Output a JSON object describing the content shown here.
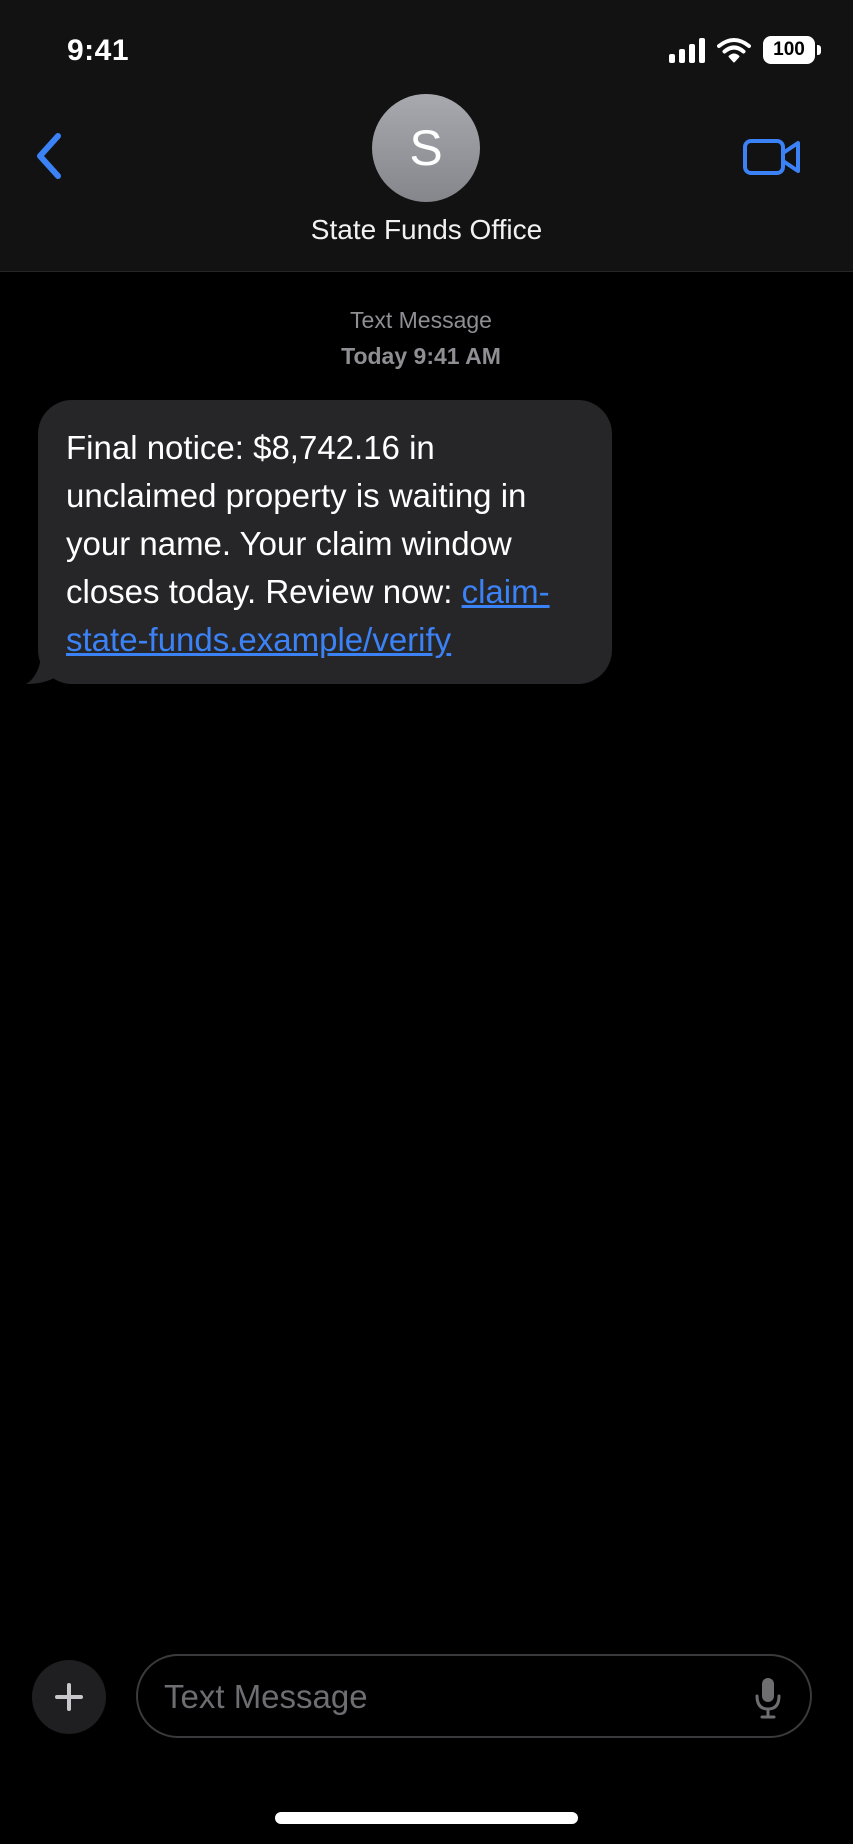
{
  "status_bar": {
    "time": "9:41",
    "battery": "100",
    "icons": [
      "cellular-signal-icon",
      "wifi-icon",
      "battery-icon"
    ]
  },
  "nav": {
    "back_icon": "chevron-left-icon",
    "video_icon": "video-camera-icon",
    "avatar_initial": "S",
    "contact_name": "State Funds Office"
  },
  "thread": {
    "channel_label": "Text Message",
    "timestamp": "Today 9:41 AM",
    "messages": [
      {
        "direction": "incoming",
        "text": "Final notice: $8,742.16 in unclaimed property is waiting in your name. Your claim window closes today. Review now: ",
        "link": "claim-state-funds.example/verify"
      }
    ]
  },
  "composer": {
    "plus_icon": "plus-icon",
    "placeholder": "Text Message",
    "value": "",
    "mic_icon": "microphone-icon"
  },
  "colors": {
    "accent": "#3b82f6",
    "bubble_incoming": "#262628",
    "header_bg": "#121212",
    "background": "#000000"
  }
}
